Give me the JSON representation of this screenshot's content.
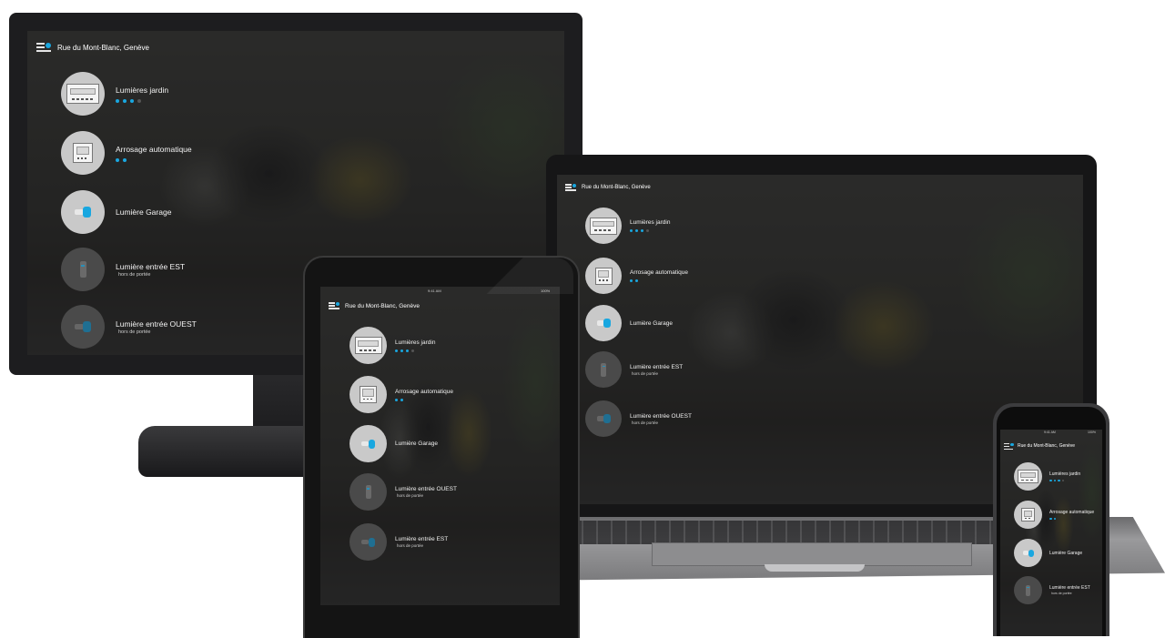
{
  "location": "Rue du Mont-Blanc, Genève",
  "accent_color": "#19a7e0",
  "status_bar": {
    "time": "9:41 AM",
    "battery": "100%"
  },
  "devices": {
    "lumieres_jardin": {
      "name": "Lumières jardin",
      "icon": "panel-device-icon",
      "active_dots": 3,
      "total_dots": 4
    },
    "arrosage": {
      "name": "Arrosage automatique",
      "icon": "controller-box-icon",
      "active_dots": 2,
      "total_dots": 2
    },
    "garage": {
      "name": "Lumière Garage",
      "icon": "plug-icon"
    },
    "entree_est": {
      "name": "Lumière entrée EST",
      "status": "hors de portée",
      "icon": "stick-sensor-icon"
    },
    "entree_ouest": {
      "name": "Lumière entrée OUEST",
      "status": "hors de portée",
      "icon": "plug-icon"
    }
  }
}
